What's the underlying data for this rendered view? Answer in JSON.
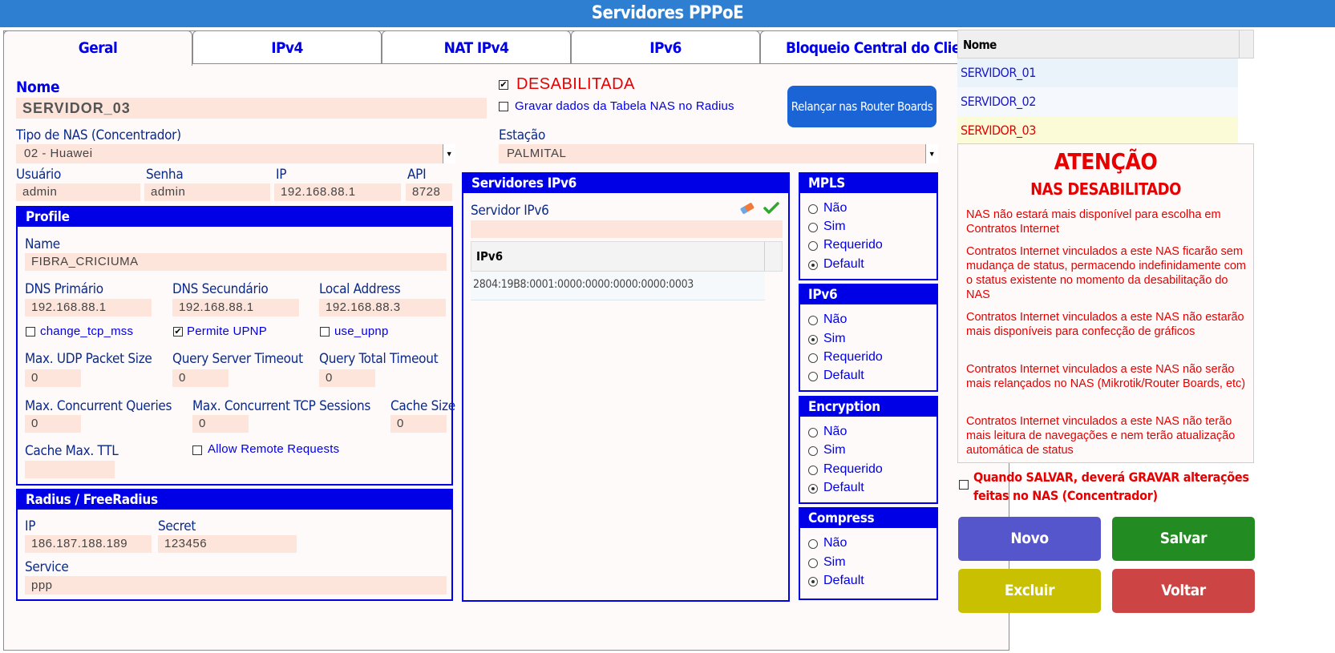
{
  "window": {
    "title": "Servidores PPPoE"
  },
  "tabs": [
    {
      "label": "Geral"
    },
    {
      "label": "IPv4"
    },
    {
      "label": "NAT IPv4"
    },
    {
      "label": "IPv6"
    },
    {
      "label": "Bloqueio Central do Cliente"
    }
  ],
  "general": {
    "nome_label": "Nome",
    "nome_value": "SERVIDOR_03",
    "desabilitada_label": "DESABILITADA",
    "desabilitada_checked": true,
    "gravar_label": "Gravar dados da Tabela NAS no Radius",
    "gravar_checked": false,
    "relancar_button": "Relançar nas Router Boards",
    "tipo_nas_label": "Tipo de NAS (Concentrador)",
    "tipo_nas_value": "02 - Huawei",
    "estacao_label": "Estação",
    "estacao_value": "PALMITAL",
    "usuario_label": "Usuário",
    "usuario_value": "admin",
    "senha_label": "Senha",
    "senha_value": "admin",
    "ip_label": "IP",
    "ip_value": "192.168.88.1",
    "api_label": "API",
    "api_value": "8728"
  },
  "profile": {
    "header": "Profile",
    "name_label": "Name",
    "name_value": "FIBRA_CRICIUMA",
    "dns1_label": "DNS Primário",
    "dns1_value": "192.168.88.1",
    "dns2_label": "DNS Secundário",
    "dns2_value": "192.168.88.1",
    "local_label": "Local Address",
    "local_value": "192.168.88.3",
    "change_tcp_mss": "change_tcp_mss",
    "permite_upnp": "Permite UPNP",
    "use_upnp": "use_upnp",
    "udp_label": "Max. UDP Packet Size",
    "udp_value": "0",
    "qst_label": "Query Server Timeout",
    "qst_value": "0",
    "qtt_label": "Query Total Timeout",
    "qtt_value": "0",
    "mcq_label": "Max. Concurrent Queries",
    "mcq_value": "0",
    "mcts_label": "Max. Concurrent TCP Sessions",
    "mcts_value": "0",
    "cache_label": "Cache Size",
    "cache_value": "0",
    "ttl_label": "Cache Max. TTL",
    "ttl_value": "",
    "allow_remote": "Allow Remote Requests"
  },
  "radius": {
    "header": "Radius / FreeRadius",
    "ip_label": "IP",
    "ip_value": "186.187.188.189",
    "secret_label": "Secret",
    "secret_value": "123456",
    "service_label": "Service",
    "service_value": "ppp"
  },
  "ipv6_servers": {
    "header": "Servidores IPv6",
    "field_label": "Servidor IPv6",
    "field_value": "",
    "table_header": "IPv6",
    "rows": [
      "2804:19B8:0001:0000:0000:0000:0000:0003"
    ]
  },
  "options": {
    "mpls": {
      "header": "MPLS",
      "items": [
        "Não",
        "Sim",
        "Requerido",
        "Default"
      ],
      "selected": "Default"
    },
    "ipv6": {
      "header": "IPv6",
      "items": [
        "Não",
        "Sim",
        "Requerido",
        "Default"
      ],
      "selected": "Sim"
    },
    "encryption": {
      "header": "Encryption",
      "items": [
        "Não",
        "Sim",
        "Requerido",
        "Default"
      ],
      "selected": "Default"
    },
    "compress": {
      "header": "Compress",
      "items": [
        "Não",
        "Sim",
        "Default"
      ],
      "selected": "Default"
    }
  },
  "server_list": {
    "header": "Nome",
    "items": [
      "SERVIDOR_01",
      "SERVIDOR_02",
      "SERVIDOR_03"
    ],
    "selected": "SERVIDOR_03"
  },
  "warning": {
    "title": "ATENÇÃO",
    "subtitle": "NAS DESABILITADO",
    "p1": "NAS não estará mais disponível para escolha em Contratos Internet",
    "p2": "Contratos Internet vinculados a este NAS ficarão sem mudança de status, permacendo indefinidamente com o status existente no momento da desabilitação do NAS",
    "p3": "Contratos Internet vinculados a este NAS não estarão mais disponíveis para confecção de gráficos",
    "p4": "Contratos Internet vinculados a este NAS não serão mais relançados no NAS (Mikrotik/Router Boards, etc)",
    "p5": "Contratos Internet vinculados a este NAS não terão mais leitura de navegações e nem terão atualização automática de status"
  },
  "save_option": {
    "label": "Quando SALVAR, deverá GRAVAR alterações feitas no NAS (Concentrador)",
    "checked": false
  },
  "actions": {
    "novo": "Novo",
    "salvar": "Salvar",
    "excluir": "Excluir",
    "voltar": "Voltar"
  },
  "colors": {
    "title_bar": "#2e7fd1",
    "accent_blue": "#0000e6",
    "input_bg": "#fde5dc",
    "novo": "#5555cc",
    "salvar": "#228b22",
    "excluir": "#c8c000",
    "voltar": "#cc4444",
    "warning": "#e60000"
  },
  "icons": {
    "erase": "eraser-icon",
    "confirm": "check-icon"
  }
}
